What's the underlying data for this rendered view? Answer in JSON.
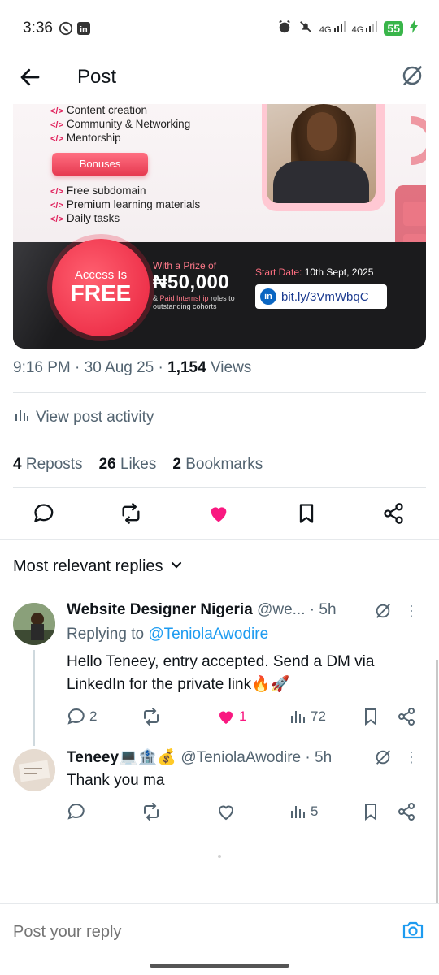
{
  "status": {
    "time": "3:36",
    "network1": "4G",
    "network2": "4G",
    "battery": "55"
  },
  "header": {
    "title": "Post"
  },
  "promo": {
    "items_top": [
      "Content creation",
      "Community & Networking",
      "Mentorship"
    ],
    "bonuses_label": "Bonuses",
    "items_bonus": [
      "Free subdomain",
      "Premium learning materials",
      "Daily tasks"
    ],
    "tag": "</>",
    "access_small": "Access Is",
    "access_big": "FREE",
    "prize_label": "With a Prize of",
    "prize_amount": "₦50,000",
    "prize_note_prefix": "& ",
    "prize_note_highlight": "Paid Internship",
    "prize_note_rest": " roles to outstanding cohorts",
    "start_label": "Start Date:",
    "start_value": "10th Sept, 2025",
    "link": "bit.ly/3VmWbqC",
    "li": "in"
  },
  "post": {
    "time": "9:16 PM",
    "date": "30 Aug 25",
    "views_count": "1,154",
    "views_label": "Views",
    "activity_label": "View post activity",
    "reposts_count": "4",
    "reposts_label": "Reposts",
    "likes_count": "26",
    "likes_label": "Likes",
    "bookmarks_count": "2",
    "bookmarks_label": "Bookmarks"
  },
  "colors": {
    "like_pink": "#f91880",
    "link_blue": "#1d9bf0",
    "muted": "#536471"
  },
  "replies_sort": "Most relevant replies",
  "replies": [
    {
      "name": "Website Designer Nigeria",
      "handle": "@we...",
      "age": "5h",
      "replying_prefix": "Replying to ",
      "replying_to": "@TeniolaAwodire",
      "text": "Hello Teneey, entry accepted. Send a DM via LinkedIn for the private link🔥🚀",
      "reply_count": "2",
      "like_count": "1",
      "view_count": "72"
    },
    {
      "name": "Teneey💻🏦💰",
      "handle": "@TeniolaAwodire",
      "age": "5h",
      "text": "Thank you ma",
      "view_count": "5"
    }
  ],
  "compose": {
    "placeholder": "Post your reply"
  }
}
